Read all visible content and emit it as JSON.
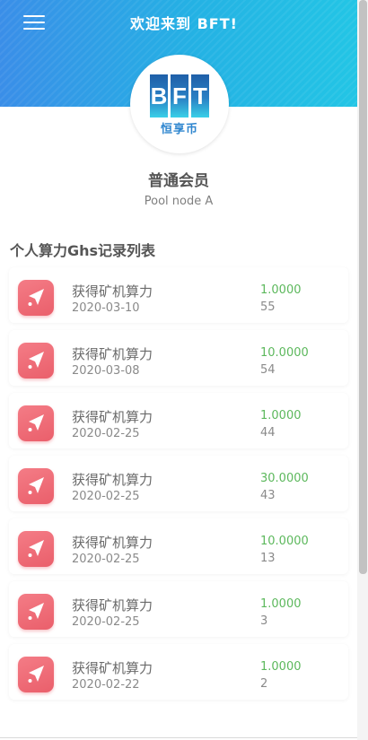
{
  "header": {
    "title": "欢迎来到 BFT!",
    "menu_icon": "hamburger-menu-icon"
  },
  "profile": {
    "logo_letters": [
      "B",
      "F",
      "T"
    ],
    "logo_subtitle": "恒享币",
    "member_level": "普通会员",
    "pool_node": "Pool node A"
  },
  "section": {
    "title": "个人算力Ghs记录列表"
  },
  "records": [
    {
      "title": "获得矿机算力",
      "date": "2020-03-10",
      "amount": "1.0000",
      "count": "55"
    },
    {
      "title": "获得矿机算力",
      "date": "2020-03-08",
      "amount": "10.0000",
      "count": "54"
    },
    {
      "title": "获得矿机算力",
      "date": "2020-02-25",
      "amount": "1.0000",
      "count": "44"
    },
    {
      "title": "获得矿机算力",
      "date": "2020-02-25",
      "amount": "30.0000",
      "count": "43"
    },
    {
      "title": "获得矿机算力",
      "date": "2020-02-25",
      "amount": "10.0000",
      "count": "13"
    },
    {
      "title": "获得矿机算力",
      "date": "2020-02-25",
      "amount": "1.0000",
      "count": "3"
    },
    {
      "title": "获得矿机算力",
      "date": "2020-02-22",
      "amount": "1.0000",
      "count": "2"
    }
  ],
  "colors": {
    "header_gradient_start": "#3a8ee8",
    "header_gradient_end": "#23c5e5",
    "amount_green": "#5cb85c",
    "icon_red": "#ea5f6b"
  }
}
